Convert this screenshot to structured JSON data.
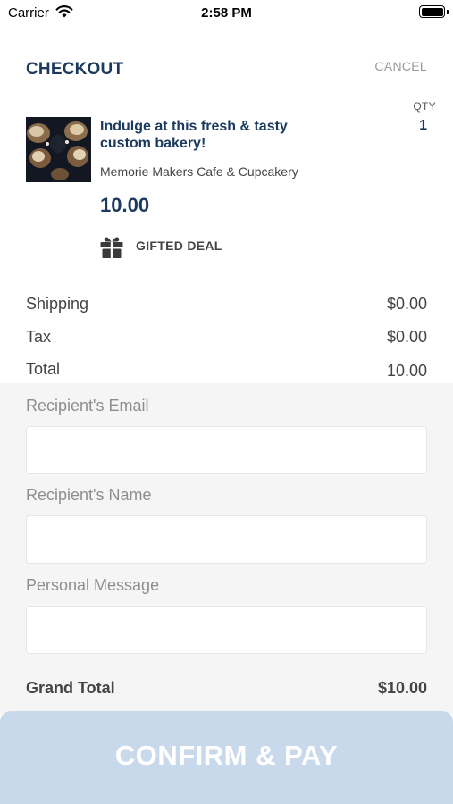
{
  "status_bar": {
    "carrier": "Carrier",
    "time": "2:58 PM"
  },
  "header": {
    "title": "CHECKOUT",
    "cancel_label": "CANCEL"
  },
  "item": {
    "qty_label": "QTY",
    "qty": "1",
    "title": "Indulge at this fresh & tasty custom bakery!",
    "vendor": "Memorie Makers Cafe & Cupcakery",
    "price": "10.00",
    "gift_label": "GIFTED DEAL",
    "thumbnail_icon": "cupcakes-photo"
  },
  "summary": {
    "shipping_label": "Shipping",
    "shipping_value": "$0.00",
    "tax_label": "Tax",
    "tax_value": "$0.00",
    "total_label": "Total",
    "total_value": "10.00"
  },
  "form": {
    "email_label": "Recipient's Email",
    "email_value": "",
    "name_label": "Recipient's Name",
    "name_value": "",
    "message_label": "Personal Message",
    "message_value": ""
  },
  "grand_total": {
    "label": "Grand Total",
    "value": "$10.00"
  },
  "confirm_label": "CONFIRM & PAY",
  "colors": {
    "brand_navy": "#1c3a5e",
    "confirm_bg": "#c8d9ec",
    "form_bg": "#f5f5f5",
    "muted_text": "#8e8e8e"
  }
}
